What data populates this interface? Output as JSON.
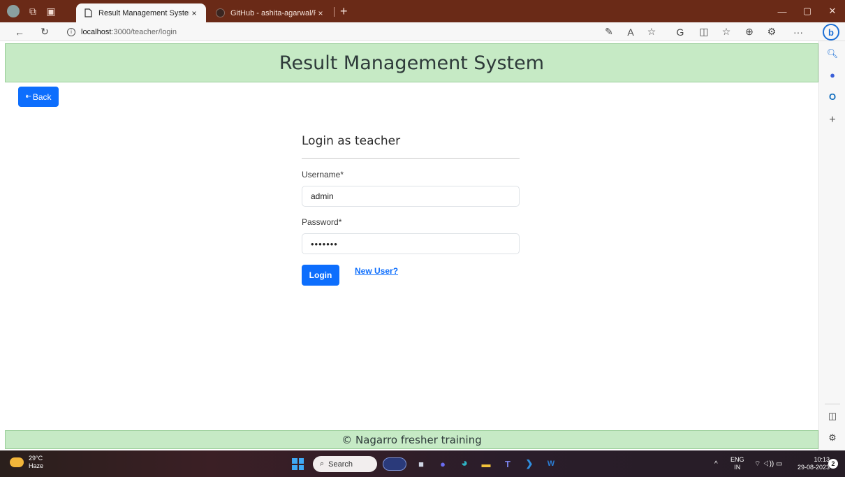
{
  "browser": {
    "tabs": [
      {
        "title": "Result Management System",
        "active": true
      },
      {
        "title": "GitHub - ashita-agarwal/Result-M",
        "active": false
      }
    ],
    "close_glyph": "×",
    "new_tab_glyph": "+",
    "url_host": "localhost",
    "url_path": ":3000/teacher/login",
    "info_glyph": "i",
    "bing_label": "b",
    "window_controls": {
      "minimize": "—",
      "restore": "▢",
      "close": "✕"
    },
    "nav": {
      "back": "←",
      "refresh": "↻"
    },
    "toolbar_icons": [
      "pen-icon",
      "read-aloud-icon",
      "favorite-star-icon",
      "copilot-icon",
      "split-screen-icon",
      "favorites-icon",
      "collections-icon",
      "extensions-icon",
      "more-icon"
    ],
    "toolbar_glyphs": {
      "pen": "✎",
      "read_aloud": "A",
      "star": "☆",
      "copilot": "G",
      "split": "◫",
      "favorites": "☆",
      "collections": "⊕",
      "extensions": "⚙",
      "more": "···"
    }
  },
  "sidebar": {
    "icons": [
      {
        "name": "search-icon",
        "glyph": "🔍︎",
        "color": "#1b6fd6"
      },
      {
        "name": "copilot-sidebar-icon",
        "glyph": "●",
        "color": "#3a5fd8"
      },
      {
        "name": "outlook-icon",
        "glyph": "O",
        "color": "#0f6cbd"
      },
      {
        "name": "add-icon",
        "glyph": "+",
        "color": "#555555"
      }
    ],
    "bottom_icons": [
      {
        "name": "sidebar-toggle-icon",
        "glyph": "◫"
      },
      {
        "name": "settings-icon",
        "glyph": "⚙"
      }
    ]
  },
  "page": {
    "header_title": "Result Management System",
    "back_arrow": "⇤",
    "back_label": "Back",
    "login_title": "Login as teacher",
    "username_label": "Username*",
    "username_value": "admin",
    "password_label": "Password*",
    "password_value": "•••••••",
    "login_button": "Login",
    "new_user_link": "New User?",
    "footer_text": "© Nagarro fresher training"
  },
  "taskbar": {
    "temperature": "29°C",
    "condition": "Haze",
    "search_placeholder": "Search",
    "search_glyph": "⌕",
    "apps": [
      {
        "name": "task-view-icon",
        "glyph": "■",
        "color": "#cfd6e4"
      },
      {
        "name": "meet-icon",
        "glyph": "●",
        "color": "#6a6cf0"
      },
      {
        "name": "edge-browser-icon",
        "glyph": "◕",
        "color": "#2fb3c4"
      },
      {
        "name": "file-explorer-icon",
        "glyph": "▬",
        "color": "#f2c23a"
      },
      {
        "name": "teams-icon",
        "glyph": "T",
        "color": "#7b83eb"
      },
      {
        "name": "vscode-icon",
        "glyph": "❯",
        "color": "#2f8fe0"
      },
      {
        "name": "word-icon",
        "glyph": "W",
        "color": "#2b7cd3"
      }
    ],
    "chevron": "^",
    "lang_top": "ENG",
    "lang_bottom": "IN",
    "tray_glyphs": "⌔ ◁)) ▭",
    "time": "10:13",
    "date": "29-08-2023",
    "notifications": "2"
  },
  "colors": {
    "accent": "#0d6efd",
    "header_bg": "#c6eac5",
    "titlebar_bg": "#6a2a17"
  }
}
